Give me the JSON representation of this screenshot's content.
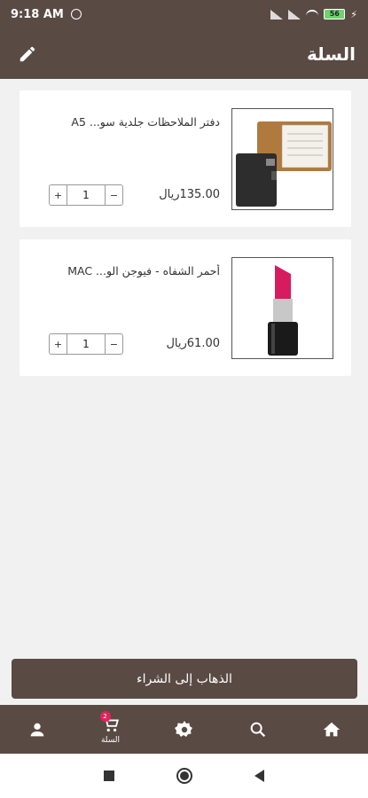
{
  "status_bar": {
    "time": "9:18 AM",
    "battery": "56"
  },
  "app_bar": {
    "title": "السلة",
    "edit_icon": "pencil-icon"
  },
  "cart": {
    "items": [
      {
        "name": "دفتر الملاحظات جلدية سو... A5",
        "price": "135.00ريال",
        "quantity": "1",
        "minus_label": "−",
        "plus_label": "+"
      },
      {
        "name": "أحمر الشفاه - فيوجن الو... MAC",
        "price": "61.00ريال",
        "quantity": "1",
        "minus_label": "−",
        "plus_label": "+"
      }
    ]
  },
  "checkout_label": "الذهاب إلى الشراء",
  "bottom_nav": {
    "items": [
      {
        "icon": "profile-icon",
        "label": ""
      },
      {
        "icon": "cart-icon",
        "label": "السلة",
        "badge": "2"
      },
      {
        "icon": "gear-icon",
        "label": ""
      },
      {
        "icon": "search-icon",
        "label": ""
      },
      {
        "icon": "home-icon",
        "label": ""
      }
    ]
  },
  "colors": {
    "brand": "#5a4a44",
    "badge": "#e0245e",
    "background": "#f1f1f1"
  }
}
